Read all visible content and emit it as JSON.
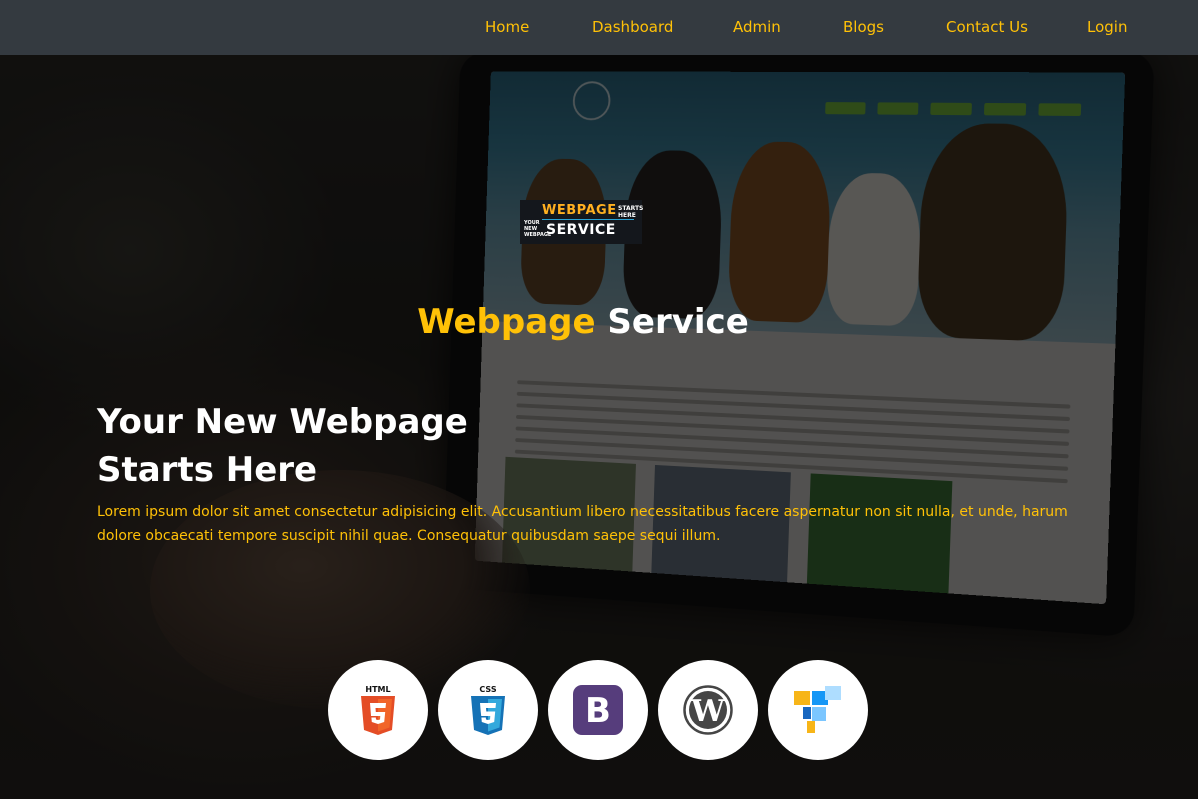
{
  "navbar": {
    "links": [
      {
        "label": "Home"
      },
      {
        "label": "Dashboard"
      },
      {
        "label": "Admin"
      },
      {
        "label": "Blogs"
      },
      {
        "label": "Contact Us"
      },
      {
        "label": "Login"
      }
    ]
  },
  "logo": {
    "word1": "WEBPAGE",
    "starts_line1": "STARTS",
    "starts_line2": "HERE",
    "your_line1": "YOUR",
    "your_line2": "NEW",
    "your_line3": "WEBPAGE",
    "word2": "SERVICE"
  },
  "hero": {
    "title_accent": "Webpage",
    "title_rest": "Service",
    "headline_line1": "Your New Webpage",
    "headline_line2": "Starts Here",
    "lede": "Lorem ipsum dolor sit amet consectetur adipisicing elit. Accusantium libero necessitatibus facere aspernatur non sit nulla, et unde, harum dolore obcaecati tempore suscipit nihil quae. Consequatur quibusdam saepe sequi illum."
  },
  "technologies": [
    {
      "icon": "html5-icon",
      "label": "HTML",
      "color": "#e44d26"
    },
    {
      "icon": "css3-icon",
      "label": "CSS",
      "color": "#1572b6"
    },
    {
      "icon": "bootstrap-icon",
      "label": "B",
      "color": "#563d7c"
    },
    {
      "icon": "wordpress-icon",
      "label": "W",
      "color": "#464646"
    },
    {
      "icon": "vuetify-icon",
      "label": "",
      "color": "#1697f6"
    }
  ],
  "colors": {
    "accent": "#ffc107",
    "navbar_bg": "#343a40"
  }
}
